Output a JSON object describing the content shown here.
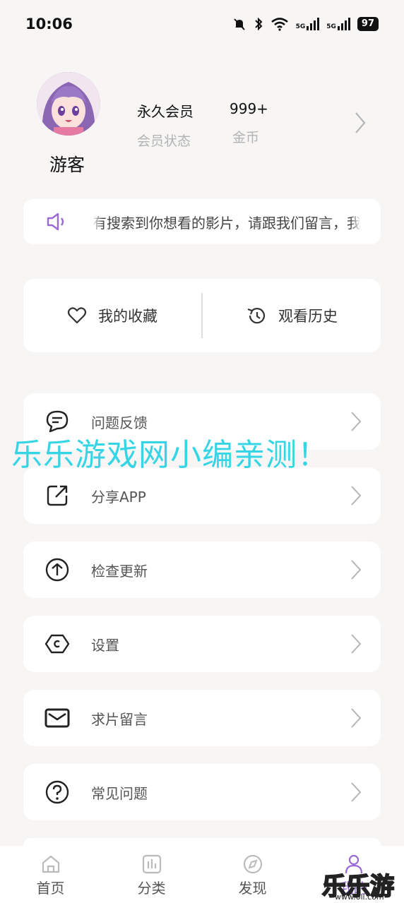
{
  "status_bar": {
    "time": "10:06",
    "network_1": "5G",
    "network_2": "5G",
    "battery": "97"
  },
  "profile": {
    "nickname": "游客",
    "membership_value": "永久会员",
    "membership_label": "会员状态",
    "coins_value": "999+",
    "coins_label": "金币"
  },
  "notice": {
    "text": "有搜索到你想看的影片，请跟我们留言，我"
  },
  "quick_actions": {
    "favorites": "我的收藏",
    "history": "观看历史"
  },
  "menu": [
    {
      "label": "问题反馈",
      "icon": "feedback-icon"
    },
    {
      "label": "分享APP",
      "icon": "share-icon"
    },
    {
      "label": "检查更新",
      "icon": "update-icon"
    },
    {
      "label": "设置",
      "icon": "settings-icon"
    },
    {
      "label": "求片留言",
      "icon": "mail-icon"
    },
    {
      "label": "常见问题",
      "icon": "question-icon"
    }
  ],
  "watermark": "乐乐游戏网小编亲测！",
  "tabbar": {
    "home": "首页",
    "category": "分类",
    "discover": "发现",
    "mine": "我的"
  },
  "corner_logo": {
    "text": "乐乐游戏",
    "url": "www.6ll.com"
  },
  "colors": {
    "accent": "#9a6ad6",
    "watermark": "#36d5e6",
    "background": "#f7f6f5"
  }
}
